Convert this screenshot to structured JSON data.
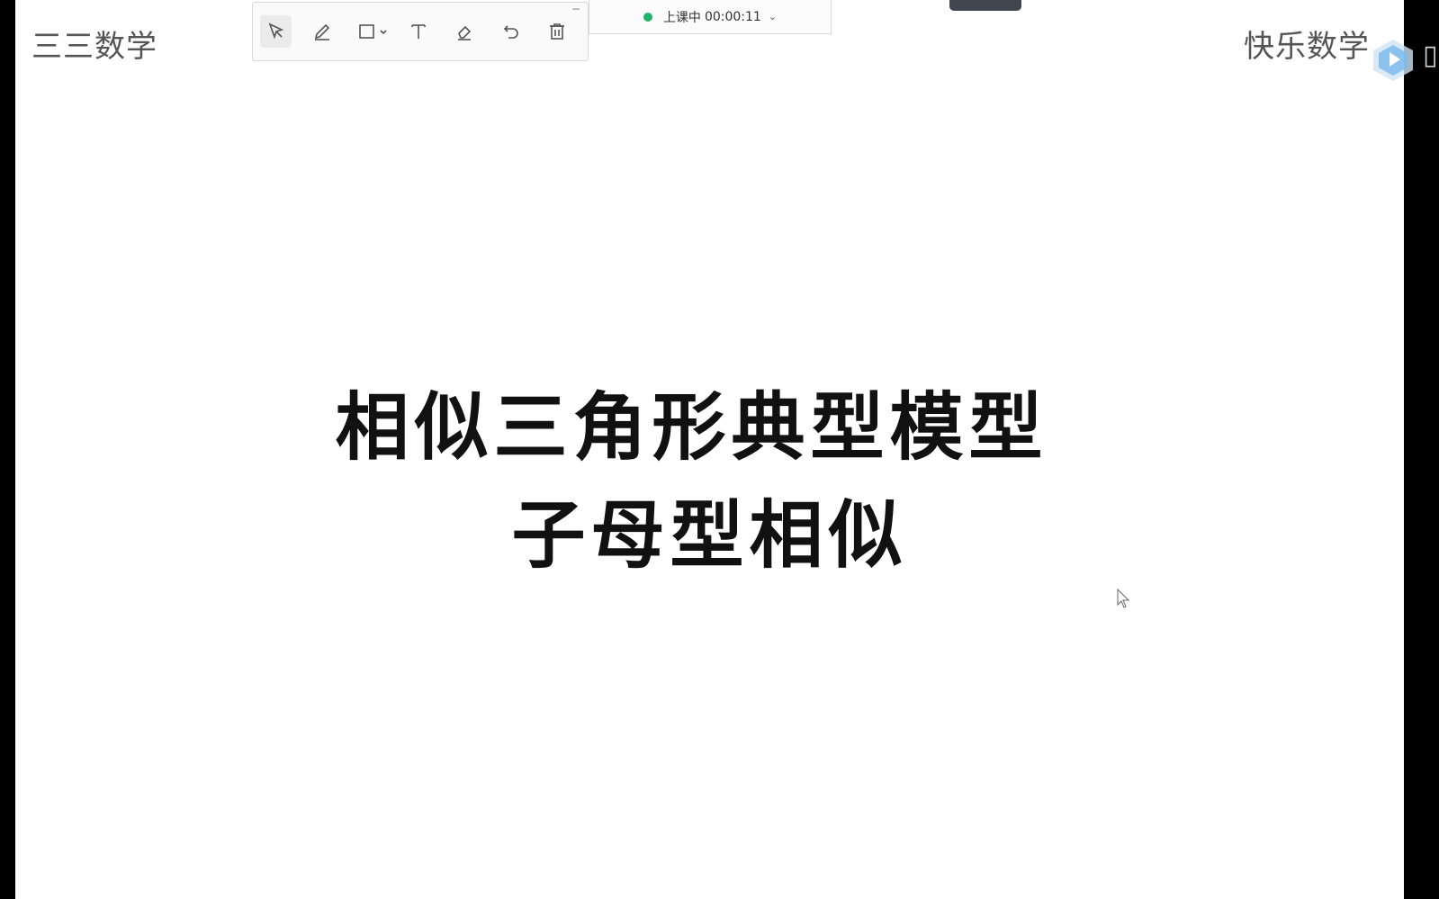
{
  "slide": {
    "corner_left": "三三数学",
    "corner_right": "快乐数学",
    "title_main": "相似三角形典型模型",
    "title_sub": "子母型相似"
  },
  "toolbar": {
    "minimize_label": "−",
    "tools": [
      "select-icon",
      "pen-icon",
      "rectangle-icon",
      "text-icon",
      "eraser-icon",
      "undo-icon",
      "delete-icon"
    ]
  },
  "status": {
    "label": "上课中",
    "timer": "00:00:11",
    "dot_color": "#1eb46b"
  },
  "side": {
    "glyph": "▯"
  },
  "colors": {
    "background": "#000000",
    "slide": "#ffffff",
    "logo_blue": "#4aa8e8"
  }
}
